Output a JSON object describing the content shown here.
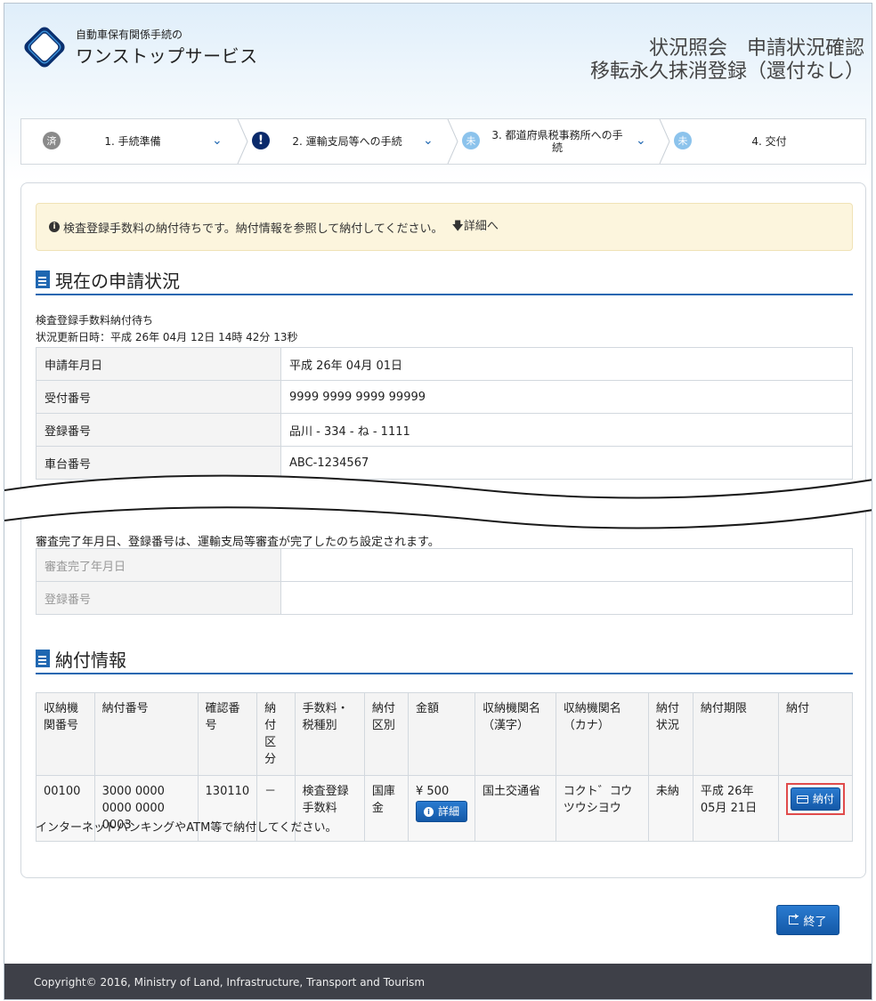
{
  "header": {
    "brand_small": "自動車保有関係手続の",
    "brand_large": "ワンストップサービス",
    "title_line1": "状況照会　申請状況確認",
    "title_line2": "移転永久抹消登録（還付なし）"
  },
  "steps": [
    {
      "badge": "済",
      "label": "1. 手続準備"
    },
    {
      "badge": "!",
      "label": "2. 運輸支局等への手続"
    },
    {
      "badge": "未",
      "label": "3. 都道府県税事務所への手続"
    },
    {
      "badge": "未",
      "label": "4. 交付"
    }
  ],
  "notice": {
    "text": "検査登録手数料の納付待ちです。納付情報を参照して納付してください。",
    "link": "詳細へ"
  },
  "current_status": {
    "heading": "現在の申請状況",
    "status_line": "検査登録手数料納付待ち",
    "updated_line": "状況更新日時：平成 26年 04月 12日 14時 42分 13秒",
    "rows": [
      {
        "key": "申請年月日",
        "value": "平成 26年 04月 01日"
      },
      {
        "key": "受付番号",
        "value": "9999 9999 9999 99999"
      },
      {
        "key": "登録番号",
        "value": "品川 - 334 - ね - 1111"
      },
      {
        "key": "車台番号",
        "value": "ABC-1234567"
      }
    ],
    "review_note": "審査完了年月日、登録番号は、運輸支局等審査が完了したのち設定されます。",
    "review_rows": [
      {
        "key": "審査完了年月日",
        "value": ""
      },
      {
        "key": "登録番号",
        "value": ""
      }
    ]
  },
  "payment": {
    "heading": "納付情報",
    "columns": [
      "収納機関番号",
      "納付番号",
      "確認番号",
      "納付区分",
      "手数料・税種別",
      "納付区別",
      "金額",
      "収納機関名（漢字）",
      "収納機関名（カナ）",
      "納付状況",
      "納付期限",
      "納付"
    ],
    "row": {
      "agency_no": "00100",
      "pay_no": "3000 0000 0000 0000 0003",
      "confirm_no": "130110",
      "pay_type": "－",
      "fee_type": "検査登録手数料",
      "pay_class": "国庫金",
      "amount": "¥ 500",
      "detail_button": "詳細",
      "agency_kanji": "国土交通省",
      "agency_kana": "コクト゛コウツウシヨウ",
      "status": "未納",
      "deadline": "平成 26年 05月 21日",
      "pay_button": "納付"
    },
    "note": "インターネットバンキングやATM等で納付してください。"
  },
  "end_button": "終了",
  "footer": "Copyright© 2016, Ministry of Land, Infrastructure, Transport and Tourism",
  "colors": {
    "accent": "#1f67b1",
    "notice_bg": "#fcf5dd",
    "footer_bg": "#3e4048",
    "highlight": "#e04b4b"
  },
  "icons": [
    "logo-icon",
    "check-badge-icon",
    "alert-badge-icon",
    "chevron-down-icon",
    "info-icon",
    "arrow-down-icon",
    "document-icon",
    "card-icon",
    "exit-icon"
  ]
}
